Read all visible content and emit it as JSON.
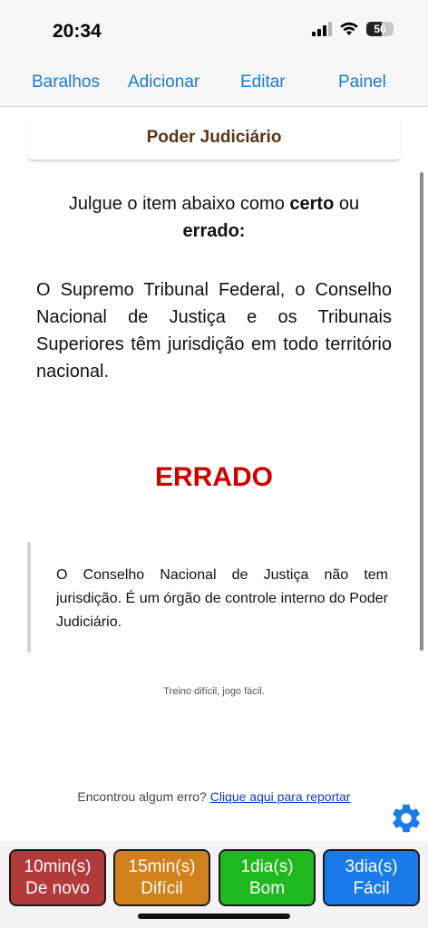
{
  "status": {
    "time": "20:34",
    "battery": "56",
    "battery_level": 0.56
  },
  "nav": {
    "decks": "Baralhos",
    "add": "Adicionar",
    "edit": "Editar",
    "panel": "Painel"
  },
  "card": {
    "deck_title": "Poder Judiciário",
    "instruction_prefix": "Julgue o item abaixo como ",
    "instruction_certo": "certo",
    "instruction_ou": " ou ",
    "instruction_errado": "errado:",
    "question": "O Supremo Tribunal Federal, o Conselho Nacional de Justiça e os Tribunais Superiores têm jurisdição em todo território nacional.",
    "answer": "ERRADO",
    "explanation": "O Conselho Nacional de Justiça não tem jurisdição. É um órgão de controle interno do Poder Judiciário.",
    "motto": "Treino difícil, jogo fácil."
  },
  "report": {
    "text": "Encontrou algum erro?",
    "link": "Clique aqui para reportar"
  },
  "buttons": [
    {
      "interval": "10min(s)",
      "label": "De novo",
      "color": "#b33a3a"
    },
    {
      "interval": "15min(s)",
      "label": "Difícil",
      "color": "#d2801b"
    },
    {
      "interval": "1dia(s)",
      "label": "Bom",
      "color": "#1fb81f"
    },
    {
      "interval": "3dia(s)",
      "label": "Fácil",
      "color": "#1a7be8"
    }
  ],
  "colors": {
    "accent": "#1a7bd8",
    "answer": "#d10000",
    "deck_title": "#5a3512",
    "gear": "#1a7be8"
  },
  "icons": [
    "signal-icon",
    "wifi-icon",
    "battery-icon",
    "gear-icon"
  ]
}
